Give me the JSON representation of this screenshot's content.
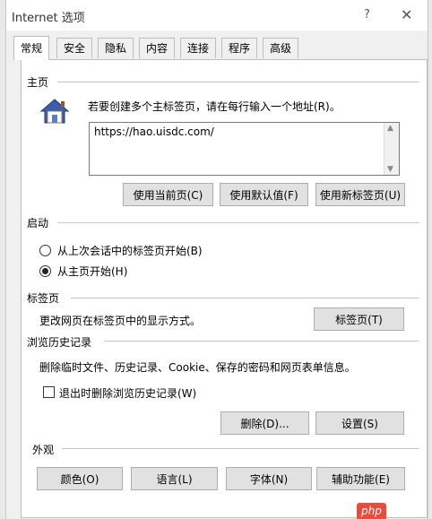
{
  "window": {
    "title": "Internet 选项",
    "help_glyph": "?",
    "close_glyph": "✕"
  },
  "tabs": [
    {
      "label": "常规",
      "active": true
    },
    {
      "label": "安全"
    },
    {
      "label": "隐私"
    },
    {
      "label": "内容"
    },
    {
      "label": "连接"
    },
    {
      "label": "程序"
    },
    {
      "label": "高级"
    }
  ],
  "homepage": {
    "section_label": "主页",
    "instruction": "若要创建多个主标签页，请在每行输入一个地址(R)。",
    "url_value": "https://hao.uisdc.com/",
    "buttons": {
      "use_current": "使用当前页(C)",
      "use_default": "使用默认值(F)",
      "use_new_tab": "使用新标签页(U)"
    }
  },
  "startup": {
    "section_label": "启动",
    "options": [
      {
        "label": "从上次会话中的标签页开始(B)",
        "selected": false
      },
      {
        "label": "从主页开始(H)",
        "selected": true
      }
    ]
  },
  "tabs_section": {
    "section_label": "标签页",
    "description": "更改网页在标签页中的显示方式。",
    "button": "标签页(T)"
  },
  "history": {
    "section_label": "浏览历史记录",
    "description": "删除临时文件、历史记录、Cookie、保存的密码和网页表单信息。",
    "checkbox_label": "退出时删除浏览历史记录(W)",
    "checkbox_checked": false,
    "delete_button": "删除(D)...",
    "settings_button": "设置(S)"
  },
  "appearance": {
    "section_label": "外观",
    "buttons": {
      "colors": "颜色(O)",
      "languages": "语言(L)",
      "fonts": "字体(N)",
      "accessibility": "辅助功能(E)"
    }
  },
  "watermark": "php",
  "colors": {
    "panel_bg": "#ffffff",
    "dialog_bg": "#f0f0f0",
    "button_bg": "#e1e1e1",
    "house_roof": "#3a5fa8",
    "watermark_bg": "#e94b3c"
  }
}
